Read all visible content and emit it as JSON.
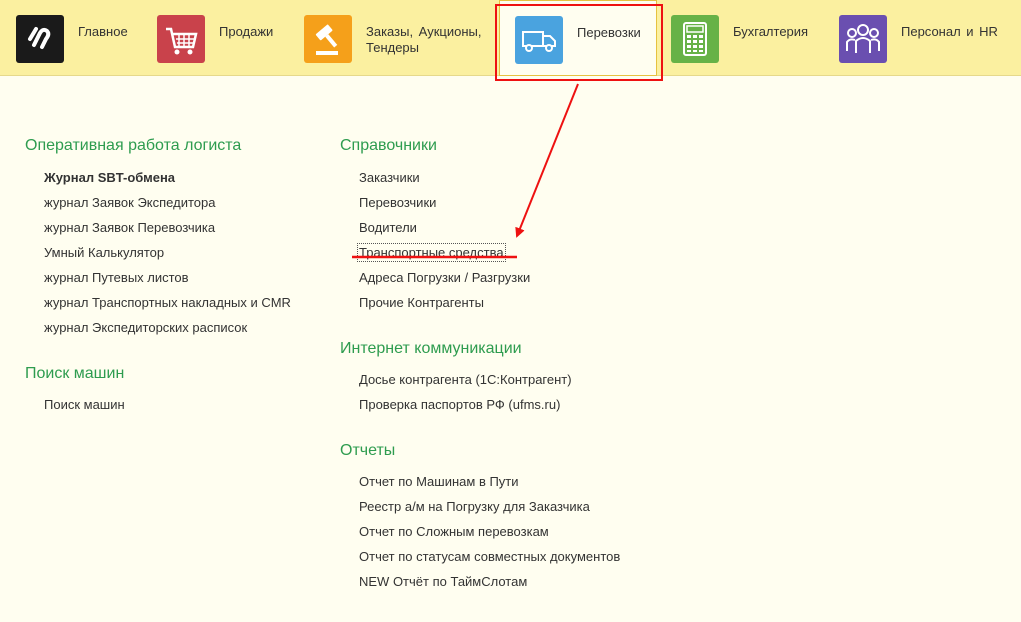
{
  "colors": {
    "header_bg": "#fbf0a0",
    "page_bg": "#fffef0",
    "group_title": "#2e9c4f",
    "annotation": "#e11111"
  },
  "sections": [
    {
      "label": "Главное",
      "icon": "logo-icon",
      "color": "#1a1a1a"
    },
    {
      "label": "Продажи",
      "icon": "cart-icon",
      "color": "#c9424b"
    },
    {
      "label": "Заказы,  Аукционы, Тендеры",
      "icon": "gavel-icon",
      "color": "#f5a01a"
    },
    {
      "label": "Перевозки",
      "icon": "truck-icon",
      "color": "#4aa3df",
      "active": true
    },
    {
      "label": "Бухгалтерия",
      "icon": "calculator-icon",
      "color": "#67b247"
    },
    {
      "label": "Персонал и HR",
      "icon": "people-icon",
      "color": "#6a4fb0"
    }
  ],
  "left": {
    "logist": {
      "title": "Оперативная работа логиста",
      "items": [
        "Журнал SBT-обмена",
        "журнал Заявок Экспедитора",
        "журнал Заявок Перевозчика",
        "Умный Калькулятор",
        "журнал Путевых листов",
        "журнал Транспортных накладных и CMR",
        "журнал Экспедиторских расписок"
      ]
    },
    "search": {
      "title": "Поиск машин",
      "items": [
        "Поиск машин"
      ]
    }
  },
  "right": {
    "refs": {
      "title": "Справочники",
      "items": [
        "Заказчики",
        "Перевозчики",
        "Водители",
        "Транспортные средства",
        "Адреса Погрузки / Разгрузки",
        "Прочие Контрагенты"
      ]
    },
    "internet": {
      "title": "Интернет коммуникации",
      "items": [
        "Досье контрагента (1С:Контрагент)",
        "Проверка паспортов РФ (ufms.ru)"
      ]
    },
    "reports": {
      "title": "Отчеты",
      "items": [
        "Отчет по Машинам в Пути",
        "Реестр а/м на Погрузку для Заказчика",
        "Отчет по Сложным перевозкам",
        "Отчет по статусам совместных документов",
        "NEW Отчёт по ТаймСлотам"
      ]
    }
  }
}
